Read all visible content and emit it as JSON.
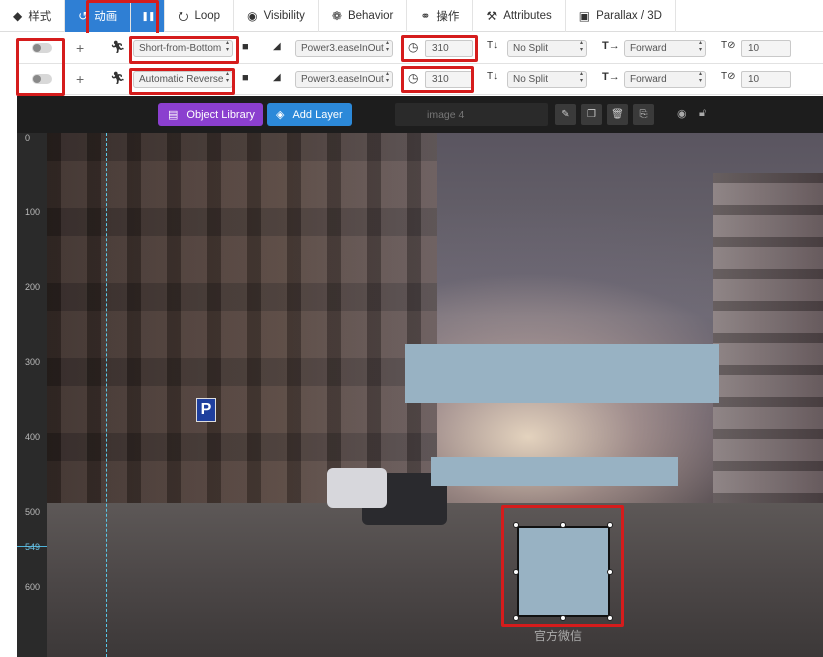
{
  "tabs": [
    {
      "label": "样式",
      "icon": "droplet-icon",
      "glyph": "◆",
      "active": false
    },
    {
      "label": "动画",
      "icon": "history-icon",
      "glyph": "↺",
      "active": true
    },
    {
      "label": "Loop",
      "icon": "loop-icon",
      "glyph": "⭮",
      "active": false
    },
    {
      "label": "Visibility",
      "icon": "eye-icon",
      "glyph": "◉",
      "active": false
    },
    {
      "label": "Behavior",
      "icon": "behavior-icon",
      "glyph": "❁",
      "active": false
    },
    {
      "label": "操作",
      "icon": "link-icon",
      "glyph": "⚭",
      "active": false
    },
    {
      "label": "Attributes",
      "icon": "tools-icon",
      "glyph": "⚒",
      "active": false
    },
    {
      "label": "Parallax / 3D",
      "icon": "image-icon",
      "glyph": "▣",
      "active": false
    }
  ],
  "pause_glyph": "❚❚",
  "anim_rows": [
    {
      "plus": "+",
      "transition": "Short-from-Bottom",
      "easing": "Power3.easeInOut",
      "duration": "310",
      "split": "No Split",
      "direction": "Forward",
      "stagger": "10"
    },
    {
      "plus": "+",
      "transition": "Automatic Reverse",
      "easing": "Power3.easeInOut",
      "duration": "310",
      "split": "No Split",
      "direction": "Forward",
      "stagger": "10"
    }
  ],
  "toolbar": {
    "object_library": "Object Library",
    "add_layer": "Add Layer",
    "layer_name_placeholder": "image 4"
  },
  "ruler": {
    "labels": [
      "0",
      "100",
      "200",
      "300",
      "400",
      "500",
      "600"
    ],
    "current": "549"
  },
  "canvas": {
    "sign_text": "P",
    "watermark": "官方微信"
  },
  "colors": {
    "accent": "#2f7fd4",
    "highlight_box": "#d51c1c",
    "object_library_btn": "#8b3fcf",
    "add_layer_btn": "#2c89d9",
    "placeholder_block": "#98b2c3",
    "guide_line": "#59c7e6"
  }
}
